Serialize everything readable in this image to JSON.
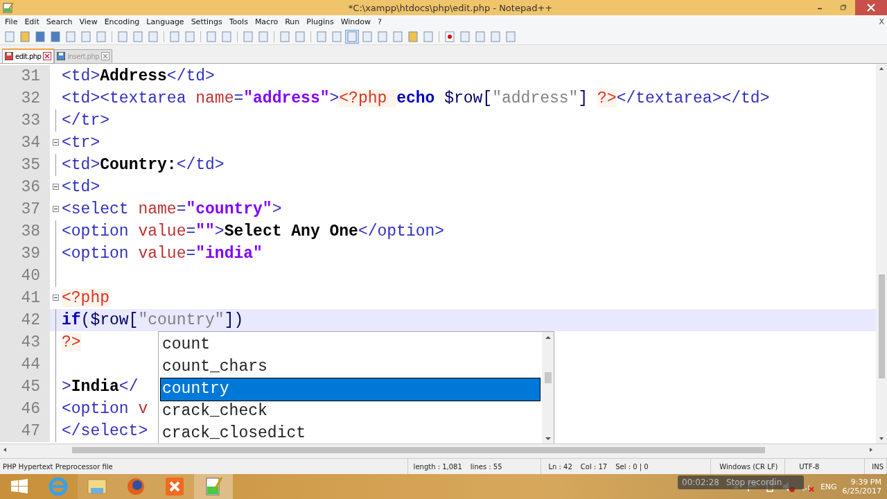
{
  "window": {
    "title": "*C:\\xampp\\htdocs\\php\\edit.php - Notepad++"
  },
  "menu": [
    "File",
    "Edit",
    "Search",
    "View",
    "Encoding",
    "Language",
    "Settings",
    "Tools",
    "Macro",
    "Run",
    "Plugins",
    "Window",
    "?"
  ],
  "menu_close": "X",
  "tabs": [
    {
      "label": "edit.php",
      "selected": true
    },
    {
      "label": "insert.php",
      "selected": false
    }
  ],
  "editor": {
    "lines": [
      {
        "number": "31",
        "fold_open": false,
        "current": false,
        "tokens": [
          {
            "kind": "tag",
            "text": "<td>"
          },
          {
            "kind": "text",
            "text": "Address"
          },
          {
            "kind": "tag",
            "text": "</td>"
          }
        ]
      },
      {
        "number": "32",
        "fold_open": false,
        "current": false,
        "tokens": [
          {
            "kind": "tag",
            "text": "<td><textarea "
          },
          {
            "kind": "attr",
            "text": "name"
          },
          {
            "kind": "tag",
            "text": "="
          },
          {
            "kind": "str",
            "text": "\"address\""
          },
          {
            "kind": "tag",
            "text": ">"
          },
          {
            "kind": "php",
            "text": "<?php "
          },
          {
            "kind": "kw",
            "text": "echo "
          },
          {
            "kind": "var",
            "text": "$row["
          },
          {
            "kind": "pstr",
            "text": "\"address\""
          },
          {
            "kind": "var",
            "text": "] "
          },
          {
            "kind": "php",
            "text": "?>"
          },
          {
            "kind": "tag",
            "text": "</textarea></td>"
          }
        ]
      },
      {
        "number": "33",
        "fold_open": false,
        "current": false,
        "tokens": [
          {
            "kind": "tag",
            "text": "</tr>"
          }
        ]
      },
      {
        "number": "34",
        "fold_open": true,
        "current": false,
        "tokens": [
          {
            "kind": "tag",
            "text": "<tr>"
          }
        ]
      },
      {
        "number": "35",
        "fold_open": false,
        "current": false,
        "tokens": [
          {
            "kind": "tag",
            "text": "<td>"
          },
          {
            "kind": "text",
            "text": "Country:"
          },
          {
            "kind": "tag",
            "text": "</td>"
          }
        ]
      },
      {
        "number": "36",
        "fold_open": true,
        "current": false,
        "tokens": [
          {
            "kind": "tag",
            "text": "<td>"
          }
        ]
      },
      {
        "number": "37",
        "fold_open": true,
        "current": false,
        "tokens": [
          {
            "kind": "tag",
            "text": "<select "
          },
          {
            "kind": "attr",
            "text": "name"
          },
          {
            "kind": "tag",
            "text": "="
          },
          {
            "kind": "str",
            "text": "\"country\""
          },
          {
            "kind": "tag",
            "text": ">"
          }
        ]
      },
      {
        "number": "38",
        "fold_open": false,
        "current": false,
        "tokens": [
          {
            "kind": "tag",
            "text": "<option "
          },
          {
            "kind": "attr",
            "text": "value"
          },
          {
            "kind": "tag",
            "text": "="
          },
          {
            "kind": "str",
            "text": "\"\""
          },
          {
            "kind": "tag",
            "text": ">"
          },
          {
            "kind": "text",
            "text": "Select Any One"
          },
          {
            "kind": "tag",
            "text": "</option>"
          }
        ]
      },
      {
        "number": "39",
        "fold_open": false,
        "current": false,
        "tokens": [
          {
            "kind": "tag",
            "text": "<option "
          },
          {
            "kind": "attr",
            "text": "value"
          },
          {
            "kind": "tag",
            "text": "="
          },
          {
            "kind": "str",
            "text": "\"india\""
          }
        ]
      },
      {
        "number": "40",
        "fold_open": false,
        "current": false
      },
      {
        "number": "41",
        "fold_open": true,
        "current": false,
        "tokens": [
          {
            "kind": "php",
            "text": "<?php"
          }
        ]
      },
      {
        "number": "42",
        "fold_open": false,
        "current": true,
        "tokens": [
          {
            "kind": "kw",
            "text": "if"
          },
          {
            "kind": "var",
            "text": "($row["
          },
          {
            "kind": "pstr",
            "text": "\"country\""
          },
          {
            "kind": "var",
            "text": "])"
          }
        ]
      },
      {
        "number": "43",
        "fold_open": false,
        "current": false,
        "tokens": [
          {
            "kind": "php",
            "text": "?>"
          }
        ]
      },
      {
        "number": "44",
        "fold_open": false,
        "current": false
      },
      {
        "number": "45",
        "fold_open": false,
        "current": false,
        "tokens": [
          {
            "kind": "tag",
            "text": ">"
          },
          {
            "kind": "text",
            "text": "India"
          },
          {
            "kind": "tag",
            "text": "</"
          }
        ]
      },
      {
        "number": "46",
        "fold_open": false,
        "current": false,
        "tokens": [
          {
            "kind": "tag",
            "text": "<option "
          },
          {
            "kind": "attr",
            "text": "v"
          }
        ]
      },
      {
        "number": "47",
        "fold_open": false,
        "current": false,
        "tokens": [
          {
            "kind": "tag",
            "text": "</select>"
          }
        ]
      }
    ]
  },
  "autocomplete": [
    {
      "label": "count",
      "selected": false
    },
    {
      "label": "count_chars",
      "selected": false
    },
    {
      "label": "country",
      "selected": true
    },
    {
      "label": "crack_check",
      "selected": false
    },
    {
      "label": "crack_closedict",
      "selected": false
    }
  ],
  "status_bar": {
    "file_type": "PHP Hypertext Preprocessor file",
    "length": "length : 1,081",
    "lines": "lines : 55",
    "position": "Ln : 42",
    "column": "Col : 17",
    "selection": "Sel : 0 | 0",
    "eol": "Windows (CR LF)",
    "encoding": "UTF-8",
    "mode": "INS"
  },
  "recording": {
    "time": "00:02:28",
    "action": "Stop recordin"
  },
  "tray": {
    "language": "ENG",
    "time": "9:39 PM",
    "date": "6/25/2017"
  }
}
